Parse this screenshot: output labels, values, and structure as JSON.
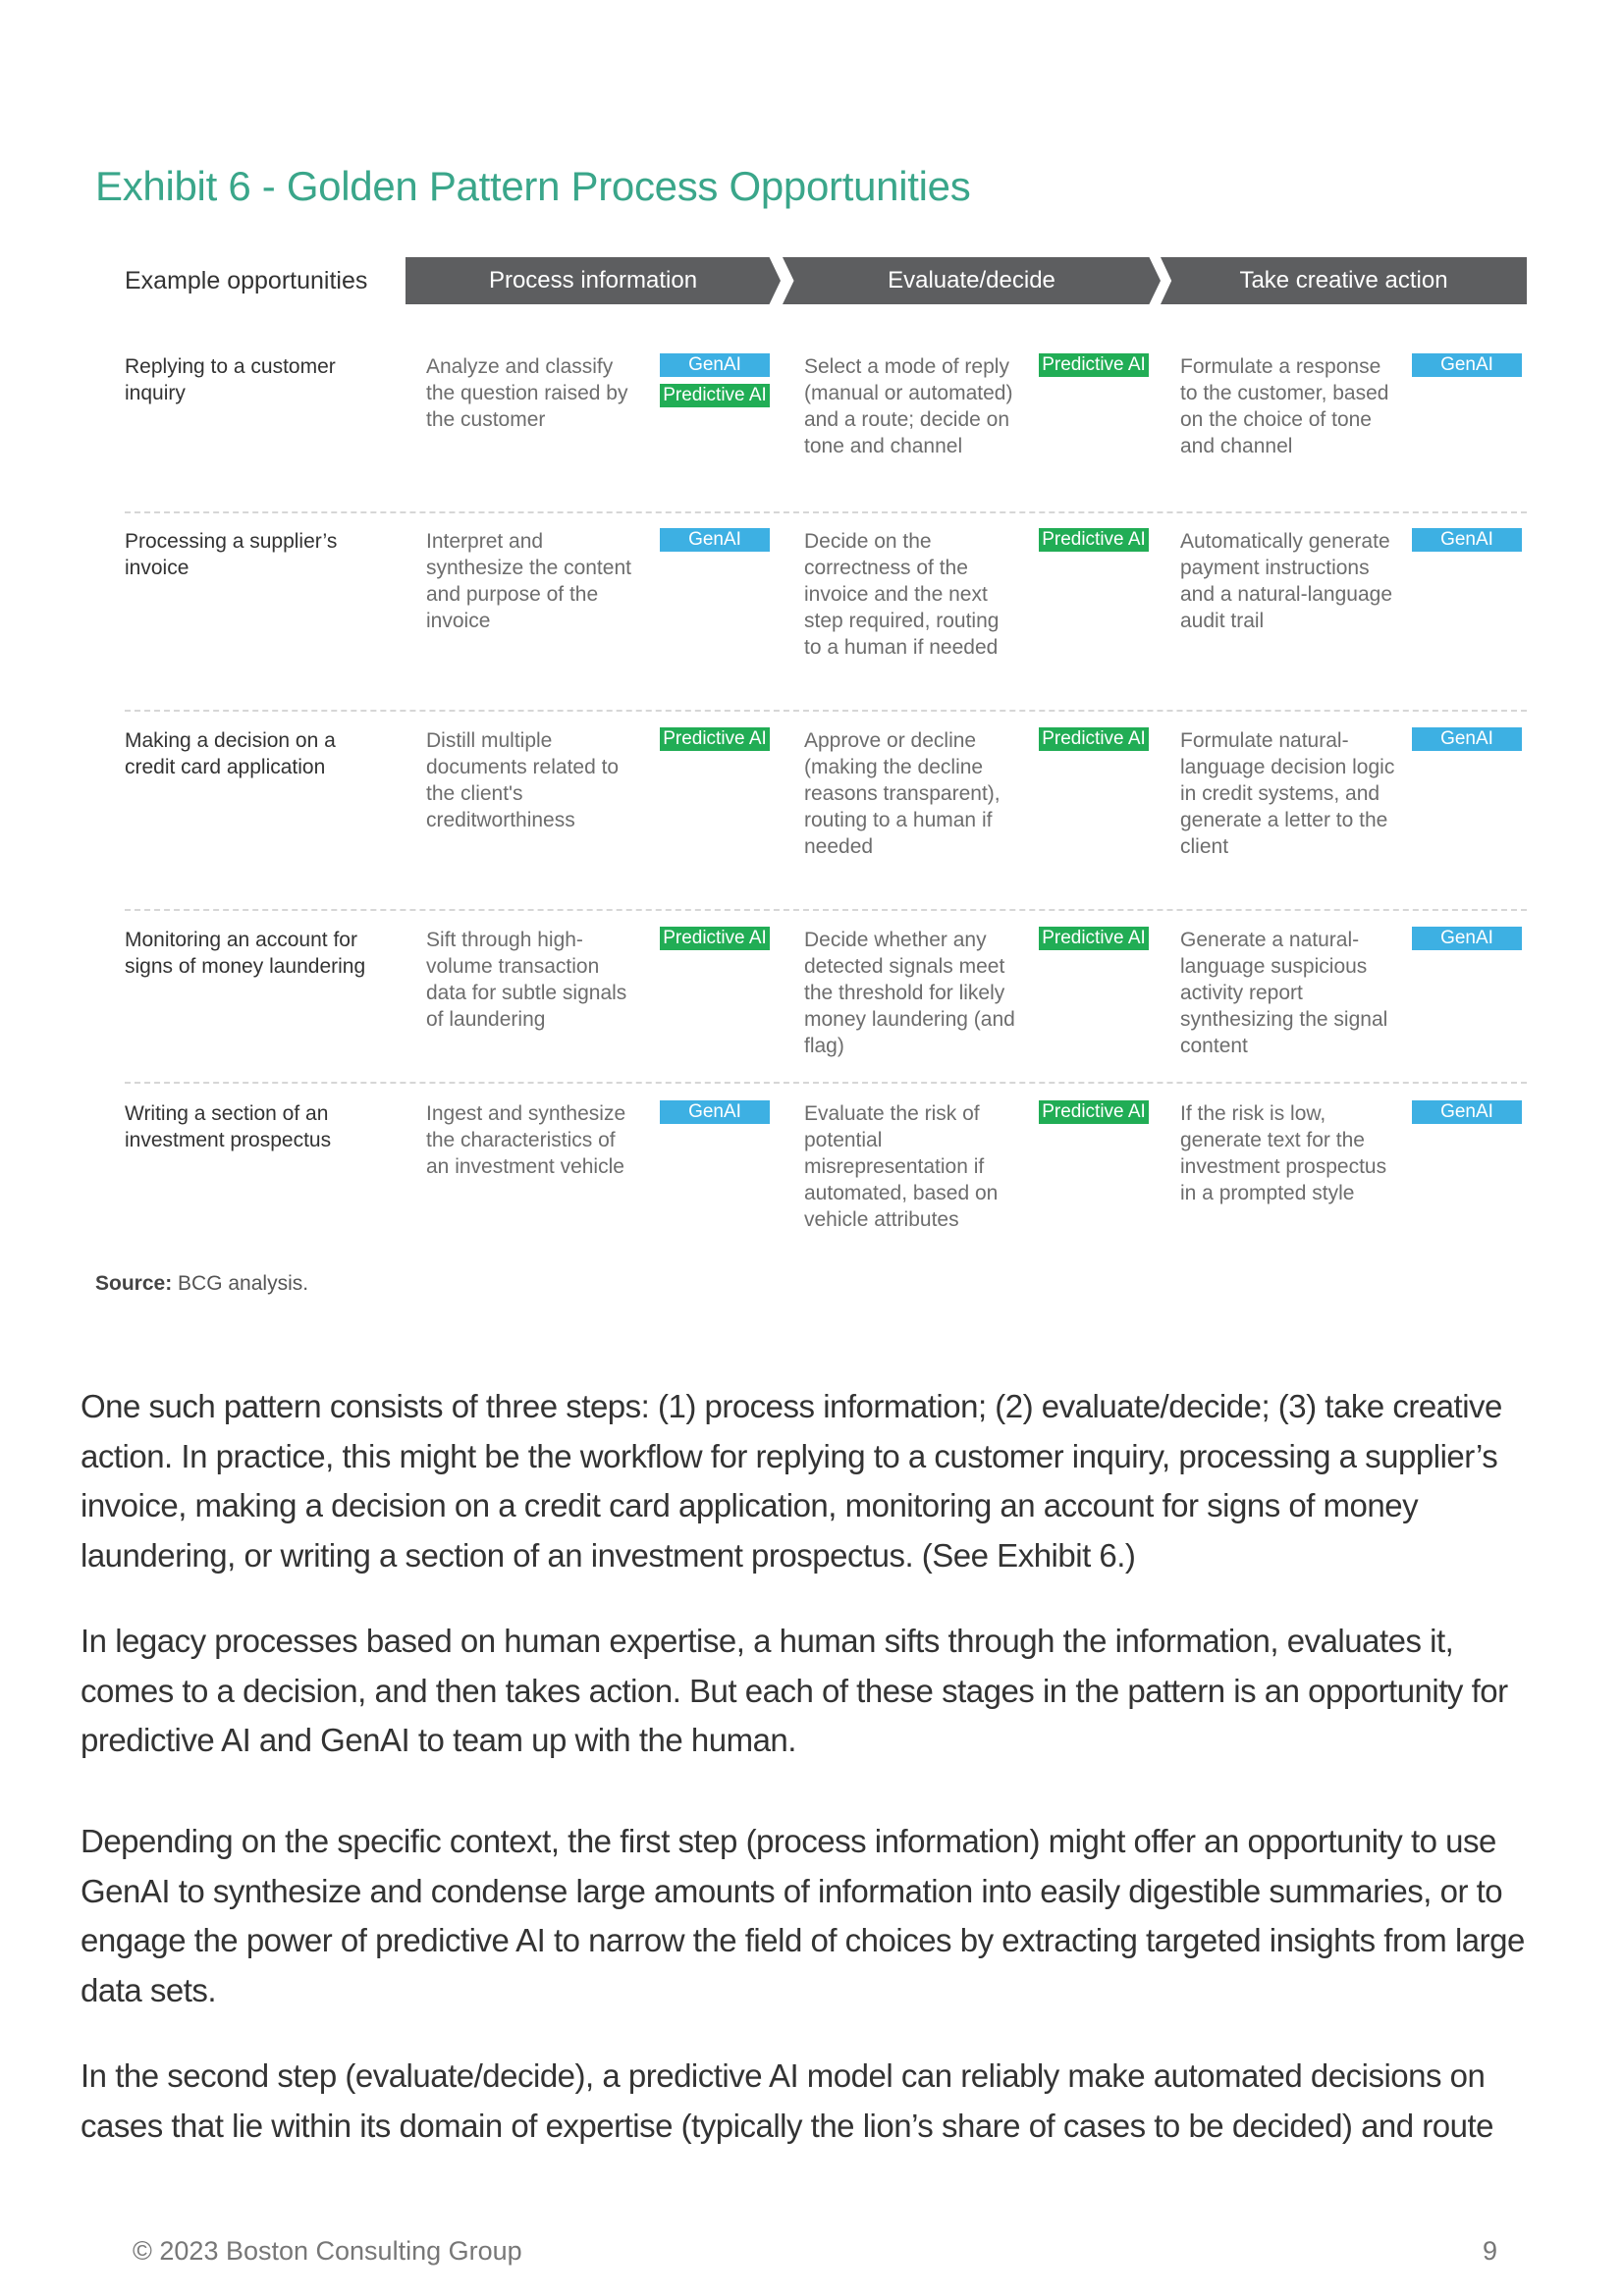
{
  "exhibit": {
    "title": "Exhibit 6 - Golden Pattern Process Opportunities",
    "header": {
      "label": "Example opportunities",
      "steps": [
        "Process information",
        "Evaluate/decide",
        "Take creative action"
      ]
    },
    "badge_colors": {
      "GenAI": "#3db0e3",
      "Predictive AI": "#21ad55"
    },
    "rows": [
      {
        "label": "Replying to a customer inquiry",
        "cells": [
          {
            "text": "Analyze and classify the question raised by the customer",
            "badges": [
              "GenAI",
              "Predictive AI"
            ]
          },
          {
            "text": "Select a mode of reply (manual or automated) and a route; decide on tone and channel",
            "badges": [
              "Predictive AI"
            ]
          },
          {
            "text": "Formulate a response to the customer, based on the choice of tone and channel",
            "badges": [
              "GenAI"
            ]
          }
        ]
      },
      {
        "label": "Processing a supplier’s invoice",
        "cells": [
          {
            "text": "Interpret and synthesize the content and purpose of the invoice",
            "badges": [
              "GenAI"
            ]
          },
          {
            "text": "Decide on the correctness of the invoice and the next step required, routing to a human if needed",
            "badges": [
              "Predictive AI"
            ]
          },
          {
            "text": "Automatically generate payment instructions and a natural-language audit trail",
            "badges": [
              "GenAI"
            ]
          }
        ]
      },
      {
        "label": "Making a decision on a credit card application",
        "cells": [
          {
            "text": "Distill multiple documents related to the client's creditworthiness",
            "badges": [
              "Predictive AI"
            ]
          },
          {
            "text": "Approve or decline (making the decline reasons transparent), routing to a human if needed",
            "badges": [
              "Predictive AI"
            ]
          },
          {
            "text": "Formulate natural-language decision logic in credit systems, and generate a letter to the client",
            "badges": [
              "GenAI"
            ]
          }
        ]
      },
      {
        "label": "Monitoring an account for signs of money laundering",
        "cells": [
          {
            "text": "Sift through high-volume transaction data for subtle signals of laundering",
            "badges": [
              "Predictive AI"
            ]
          },
          {
            "text": "Decide whether any detected signals meet the threshold for likely money laundering (and flag)",
            "badges": [
              "Predictive AI"
            ]
          },
          {
            "text": "Generate a natural-language suspicious activity report synthesizing the signal content",
            "badges": [
              "GenAI"
            ]
          }
        ]
      },
      {
        "label": "Writing a section of an investment prospectus",
        "cells": [
          {
            "text": "Ingest and synthesize the characteristics of an investment vehicle",
            "badges": [
              "GenAI"
            ]
          },
          {
            "text": "Evaluate the risk of potential misrepresentation if automated, based on vehicle attributes",
            "badges": [
              "Predictive AI"
            ]
          },
          {
            "text": "If the risk is low, generate text for the investment prospectus in a prompted style",
            "badges": [
              "GenAI"
            ]
          }
        ]
      }
    ],
    "source_label": "Source:",
    "source_text": " BCG analysis."
  },
  "body": {
    "paragraphs": [
      "One such pattern consists of three steps: (1) process information; (2) evaluate/decide; (3) take creative action. In practice, this might be the workflow for replying to a customer inquiry, processing a supplier’s invoice, making a decision on a credit card application, monitoring an account for signs of money laundering, or writing a section of an investment prospectus. (See Exhibit 6.)",
      "In legacy processes based on human expertise, a human sifts through the information, evaluates it, comes to a decision, and then takes action. But each of these stages in the pattern is an opportunity for predictive AI and GenAI to team up with the human.",
      "Depending on the specific context, the first step (process information) might offer an opportunity to use GenAI to synthesize and condense large amounts of information into easily digestible summaries, or to engage the power of predictive AI to narrow the field of choices by extracting targeted insights from large data sets.",
      "In the second step (evaluate/decide), a predictive AI model can reliably make automated decisions on cases that lie within its domain of expertise (typically the lion’s share of cases to be decided) and route"
    ]
  },
  "footer": {
    "copyright": "© 2023 Boston Consulting Group",
    "page_number": "9"
  }
}
